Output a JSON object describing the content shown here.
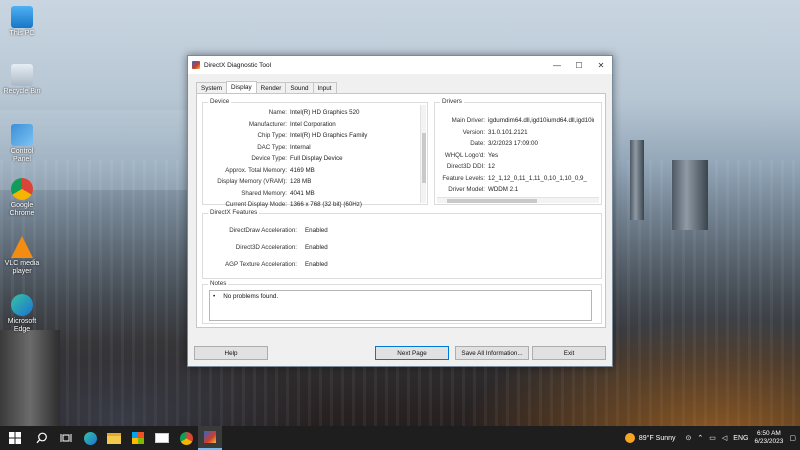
{
  "desktop": {
    "icons": [
      {
        "label": "This PC",
        "icon": "this-pc-icon"
      },
      {
        "label": "Recycle Bin",
        "icon": "recycle-bin-icon"
      },
      {
        "label": "Control Panel",
        "icon": "control-panel-icon"
      },
      {
        "label": "Google Chrome",
        "icon": "chrome-icon"
      },
      {
        "label": "VLC media player",
        "icon": "vlc-icon"
      },
      {
        "label": "Microsoft Edge",
        "icon": "edge-icon"
      }
    ]
  },
  "window": {
    "title": "DirectX Diagnostic Tool",
    "minimize": "—",
    "maximize": "☐",
    "close": "✕",
    "tabs": [
      "System",
      "Display",
      "Render",
      "Sound",
      "Input"
    ],
    "active_tab": "Display",
    "device": {
      "title": "Device",
      "rows": [
        {
          "label": "Name:",
          "value": "Intel(R) HD Graphics 520"
        },
        {
          "label": "Manufacturer:",
          "value": "Intel Corporation"
        },
        {
          "label": "Chip Type:",
          "value": "Intel(R) HD Graphics Family"
        },
        {
          "label": "DAC Type:",
          "value": "Internal"
        },
        {
          "label": "Device Type:",
          "value": "Full Display Device"
        },
        {
          "label": "Approx. Total Memory:",
          "value": "4169 MB"
        },
        {
          "label": "Display Memory (VRAM):",
          "value": "128 MB"
        },
        {
          "label": "Shared Memory:",
          "value": "4041 MB"
        },
        {
          "label": "Current Display Mode:",
          "value": "1366 x 768 (32 bit) (60Hz)"
        }
      ]
    },
    "drivers": {
      "title": "Drivers",
      "rows": [
        {
          "label": "Main Driver:",
          "value": "igdumdim64.dll,igd10iumd64.dll,igd10iu"
        },
        {
          "label": "Version:",
          "value": "31.0.101.2121"
        },
        {
          "label": "Date:",
          "value": "3/2/2023 17:09:00"
        },
        {
          "label": "WHQL Logo'd:",
          "value": "Yes"
        },
        {
          "label": "Direct3D DDI:",
          "value": "12"
        },
        {
          "label": "Feature Levels:",
          "value": "12_1,12_0,11_1,11_0,10_1,10_0,9_"
        },
        {
          "label": "Driver Model:",
          "value": "WDDM 2.1"
        }
      ]
    },
    "features": {
      "title": "DirectX Features",
      "rows": [
        {
          "label": "DirectDraw Acceleration:",
          "value": "Enabled"
        },
        {
          "label": "Direct3D Acceleration:",
          "value": "Enabled"
        },
        {
          "label": "AGP Texture Acceleration:",
          "value": "Enabled"
        }
      ]
    },
    "notes": {
      "title": "Notes",
      "items": [
        "No problems found."
      ]
    },
    "buttons": {
      "help": "Help",
      "next": "Next Page",
      "save": "Save All Information...",
      "exit": "Exit"
    }
  },
  "taskbar": {
    "weather": "89°F  Sunny",
    "language": "ENG",
    "time": "6:50 AM",
    "date": "6/23/2023"
  }
}
